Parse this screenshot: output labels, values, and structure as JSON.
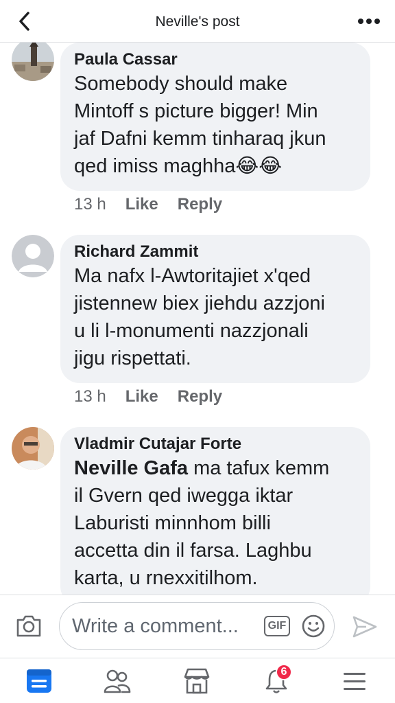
{
  "header": {
    "title": "Neville's post",
    "back_icon": "chevron-left-icon",
    "more_icon": "more-horizontal-icon"
  },
  "comments": [
    {
      "author": "Paula Cassar",
      "avatar": "tower-photo-avatar",
      "text": "Somebody should make\nMintoff s picture bigger! Min\njaf Dafni kemm tinharaq jkun\nqed imiss maghha😂😂",
      "time": "13 h",
      "like_label": "Like",
      "reply_label": "Reply"
    },
    {
      "author": "Richard Zammit",
      "avatar": "default-person-avatar",
      "text": "Ma nafx  l-Awtoritajiet x'qed\njistennew biex jiehdu azzjoni\nu li l-monumenti nazzjonali\njigu rispettati.",
      "time": "13 h",
      "like_label": "Like",
      "reply_label": "Reply"
    },
    {
      "author": "Vladmir Cutajar Forte",
      "avatar": "man-photo-avatar",
      "mention": "Neville Gafa",
      "text": " ma tafux kemm\nil Gvern qed iwegga iktar\nLaburisti minnhom billi\naccetta din il farsa. Laghbu\nkarta, u rnexxitilhom."
    }
  ],
  "composer": {
    "placeholder": "Write a comment...",
    "gif_label": "GIF",
    "camera_icon": "camera-icon",
    "emoji_icon": "smiley-icon",
    "send_icon": "send-icon"
  },
  "tabbar": {
    "notifications_badge": "6",
    "active_color": "#1877f2"
  }
}
